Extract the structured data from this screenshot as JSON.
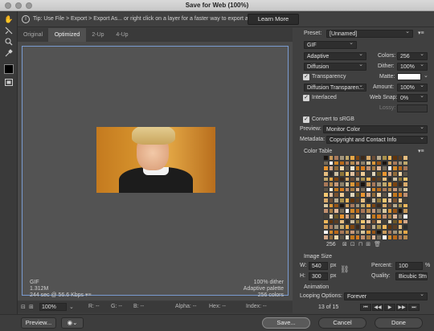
{
  "window": {
    "title": "Save for Web (100%)"
  },
  "tip": {
    "text": "Tip: Use File > Export > Export As...  or right click on a layer for a faster way to export assets",
    "learn_more": "Learn More"
  },
  "tabs": [
    {
      "label": "Original"
    },
    {
      "label": "Optimized"
    },
    {
      "label": "2-Up"
    },
    {
      "label": "4-Up"
    }
  ],
  "active_tab": "Optimized",
  "image_info": {
    "format": "GIF",
    "size": "1.312M",
    "speed": "244 sec @ 56.6 Kbps",
    "dither": "100% dither",
    "palette": "Adaptive palette",
    "colors": "256 colors"
  },
  "status": {
    "zoom": "100%",
    "r": "R: --",
    "g": "G: --",
    "b": "B: --",
    "alpha": "Alpha: --",
    "hex": "Hex: --",
    "index": "Index: --"
  },
  "settings": {
    "preset_label": "Preset:",
    "preset_value": "[Unnamed]",
    "format": "GIF",
    "reduction": "Adaptive",
    "colors_label": "Colors:",
    "colors_value": "256",
    "dither_algo": "Diffusion",
    "dither_label": "Dither:",
    "dither_value": "100%",
    "transparency_label": "Transparency",
    "transparency_checked": true,
    "matte_label": "Matte:",
    "matte_color": "#ffffff",
    "trans_dither": "Diffusion Transparen...",
    "amount_label": "Amount:",
    "amount_value": "100%",
    "interlaced_label": "Interlaced",
    "interlaced_checked": true,
    "websnap_label": "Web Snap:",
    "websnap_value": "0%",
    "lossy_label": "Lossy:",
    "convert_srgb_label": "Convert to sRGB",
    "convert_srgb_checked": true,
    "preview_label": "Preview:",
    "preview_value": "Monitor Color",
    "metadata_label": "Metadata:",
    "metadata_value": "Copyright and Contact Info",
    "color_table_label": "Color Table",
    "color_count": "256"
  },
  "image_size": {
    "heading": "Image Size",
    "w_label": "W:",
    "w_value": "540",
    "h_label": "H:",
    "h_value": "300",
    "unit": "px",
    "percent_label": "Percent:",
    "percent_value": "100",
    "percent_unit": "%",
    "quality_label": "Quality:",
    "quality_value": "Bicubic Smoother"
  },
  "animation": {
    "heading": "Animation",
    "looping_label": "Looping Options:",
    "looping_value": "Forever",
    "frame_counter": "13 of 15"
  },
  "buttons": {
    "preview": "Preview...",
    "save": "Save...",
    "cancel": "Cancel",
    "done": "Done"
  },
  "colors": {
    "panel_bg": "#404040",
    "accent_border": "#7a9bd0",
    "palette": [
      "#1a1410",
      "#3b2a1c",
      "#5a3d22",
      "#7a5230",
      "#8f6a3a",
      "#a47a44",
      "#b88a4e",
      "#c99a5a",
      "#d8aa6a",
      "#e4bd80",
      "#eccb96",
      "#f2d8ac",
      "#e0b898",
      "#c89a7a",
      "#a87a5c",
      "#6a4c36",
      "#2c2c2c",
      "#444038",
      "#5c5448",
      "#746a5a",
      "#8c806a",
      "#a0947c",
      "#b8aa8e",
      "#ccc0a4",
      "#e0d6bc",
      "#f0e8d4",
      "#ffffff",
      "#d8c8a0",
      "#c0a86c",
      "#a8904c",
      "#8c7438",
      "#6c5828",
      "#c4781c",
      "#d0882a",
      "#dc9838",
      "#e6a848",
      "#eeb85c",
      "#f4c870",
      "#e89430",
      "#d47c20",
      "#b86818",
      "#985414",
      "#7c4410",
      "#60340c",
      "#e0c0a0",
      "#d4a888",
      "#c09070",
      "#a87858"
    ]
  }
}
